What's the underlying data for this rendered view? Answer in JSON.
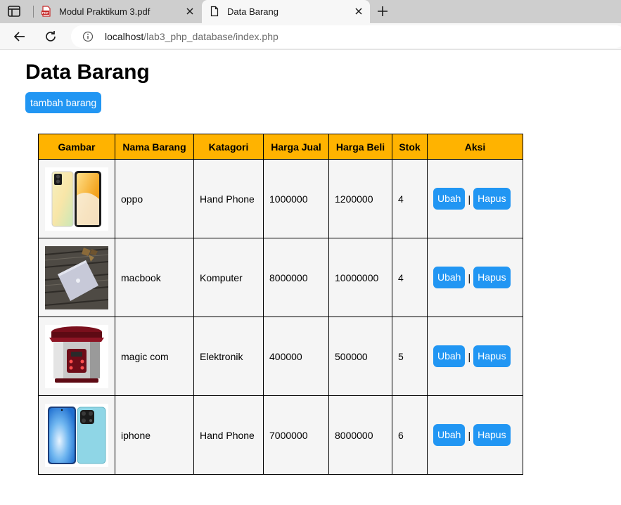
{
  "browser": {
    "tabs": [
      {
        "title": "Modul Praktikum 3.pdf",
        "icon": "pdf-icon",
        "active": false
      },
      {
        "title": "Data Barang",
        "icon": "document-icon",
        "active": true
      }
    ],
    "url_host": "localhost",
    "url_path": "/lab3_php_database/index.php"
  },
  "page": {
    "title": "Data Barang",
    "add_button": "tambah barang"
  },
  "table": {
    "headers": [
      "Gambar",
      "Nama Barang",
      "Katagori",
      "Harga Jual",
      "Harga Beli",
      "Stok",
      "Aksi"
    ],
    "rows": [
      {
        "image": "oppo-phone-image",
        "nama": "oppo",
        "kategori": "Hand Phone",
        "harga_jual": "1000000",
        "harga_beli": "1200000",
        "stok": "4"
      },
      {
        "image": "macbook-image",
        "nama": "macbook",
        "kategori": "Komputer",
        "harga_jual": "8000000",
        "harga_beli": "10000000",
        "stok": "4"
      },
      {
        "image": "rice-cooker-image",
        "nama": "magic com",
        "kategori": "Elektronik",
        "harga_jual": "400000",
        "harga_beli": "500000",
        "stok": "5"
      },
      {
        "image": "iphone-image",
        "nama": "iphone",
        "kategori": "Hand Phone",
        "harga_jual": "7000000",
        "harga_beli": "8000000",
        "stok": "6"
      }
    ],
    "edit_label": "Ubah",
    "separator": "|",
    "delete_label": "Hapus"
  },
  "colors": {
    "button": "#2196f3",
    "header_bg": "#ffb300",
    "row_bg": "#f5f5f5"
  }
}
